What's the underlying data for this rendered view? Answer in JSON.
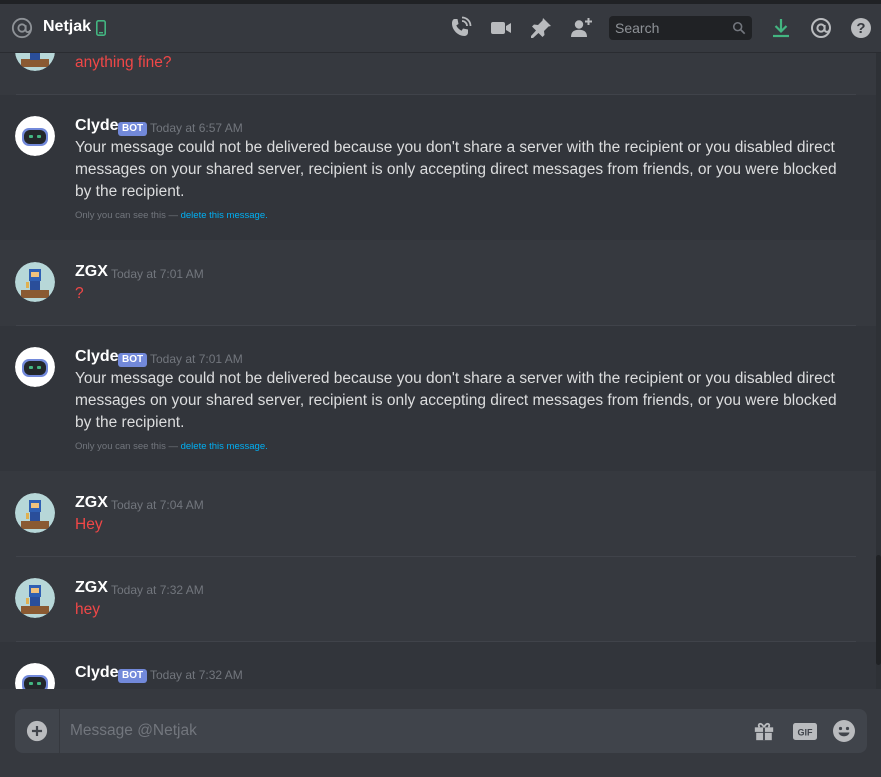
{
  "header": {
    "channel_name": "Netjak",
    "search_placeholder": "Search"
  },
  "messages": [
    {
      "id": "partial-top",
      "author": "ZGX",
      "text": "anything fine?",
      "text_color": "#f04747"
    },
    {
      "id": "m1",
      "author": "Clyde",
      "bot_label": "BOT",
      "timestamp": "Today at 6:57 AM",
      "text": "Your message could not be delivered because you don't share a server with the recipient or you disabled direct messages on your shared server, recipient is only accepting direct messages from friends, or you were blocked by the recipient.",
      "note_prefix": "Only you can see this — ",
      "note_link": "delete this message."
    },
    {
      "id": "m2",
      "author": "ZGX",
      "timestamp": "Today at 7:01 AM",
      "text": "?",
      "text_color": "#f04747"
    },
    {
      "id": "m3",
      "author": "Clyde",
      "bot_label": "BOT",
      "timestamp": "Today at 7:01 AM",
      "text": "Your message could not be delivered because you don't share a server with the recipient or you disabled direct messages on your shared server, recipient is only accepting direct messages from friends, or you were blocked by the recipient.",
      "note_prefix": "Only you can see this — ",
      "note_link": "delete this message."
    },
    {
      "id": "m4",
      "author": "ZGX",
      "timestamp": "Today at 7:04 AM",
      "text": "Hey",
      "text_color": "#f04747"
    },
    {
      "id": "m5",
      "author": "ZGX",
      "timestamp": "Today at 7:32 AM",
      "text": "hey",
      "text_color": "#f04747"
    },
    {
      "id": "m6",
      "author": "Clyde",
      "bot_label": "BOT",
      "timestamp": "Today at 7:32 AM"
    }
  ],
  "composer": {
    "placeholder": "Message @Netjak",
    "gif_label": "GIF"
  },
  "colors": {
    "background": "#36393f",
    "accent": "#7289da",
    "link": "#00b0f4",
    "download": "#43b581",
    "mobile_online": "#43b581"
  },
  "icons": [
    "at-icon",
    "mobile-icon",
    "start-voice-call-icon",
    "start-video-call-icon",
    "pin-icon",
    "add-friend-icon",
    "search-icon",
    "download-icon",
    "mentions-icon",
    "help-icon",
    "plus-circle-icon",
    "gift-icon",
    "gif-icon",
    "emoji-icon"
  ]
}
